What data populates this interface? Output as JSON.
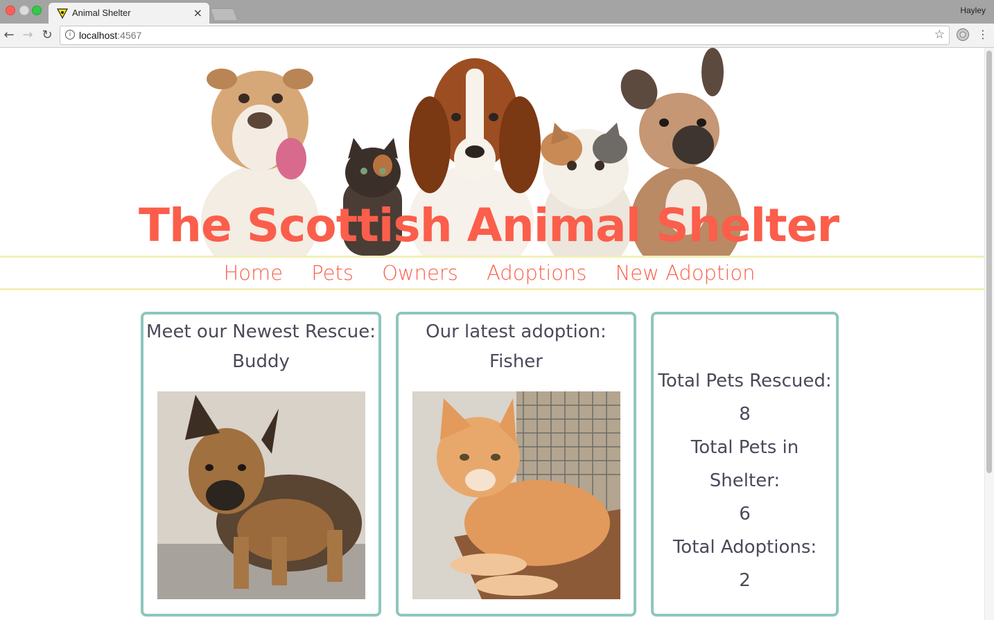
{
  "browser": {
    "tab_title": "Animal Shelter",
    "tab_close": "×",
    "profile_name": "Hayley",
    "url_host": "localhost",
    "url_port": ":4567"
  },
  "site": {
    "title": "The Scottish Animal Shelter",
    "nav": [
      "Home",
      "Pets",
      "Owners",
      "Adoptions",
      "New Adoption"
    ]
  },
  "newest_rescue": {
    "heading": "Meet our Newest Rescue:",
    "name": "Buddy"
  },
  "latest_adoption": {
    "heading": "Our latest adoption:",
    "name": "Fisher"
  },
  "stats": {
    "rescued_label": "Total Pets Rescued:",
    "rescued_value": "8",
    "in_shelter_label": "Total Pets in Shelter:",
    "in_shelter_value": "6",
    "adoptions_label": "Total Adoptions:",
    "adoptions_value": "2"
  },
  "colors": {
    "accent": "#fb5e4b",
    "nav_border": "#f1f0b6",
    "card_border": "#8ec6bd",
    "text": "#4a4a5a"
  }
}
